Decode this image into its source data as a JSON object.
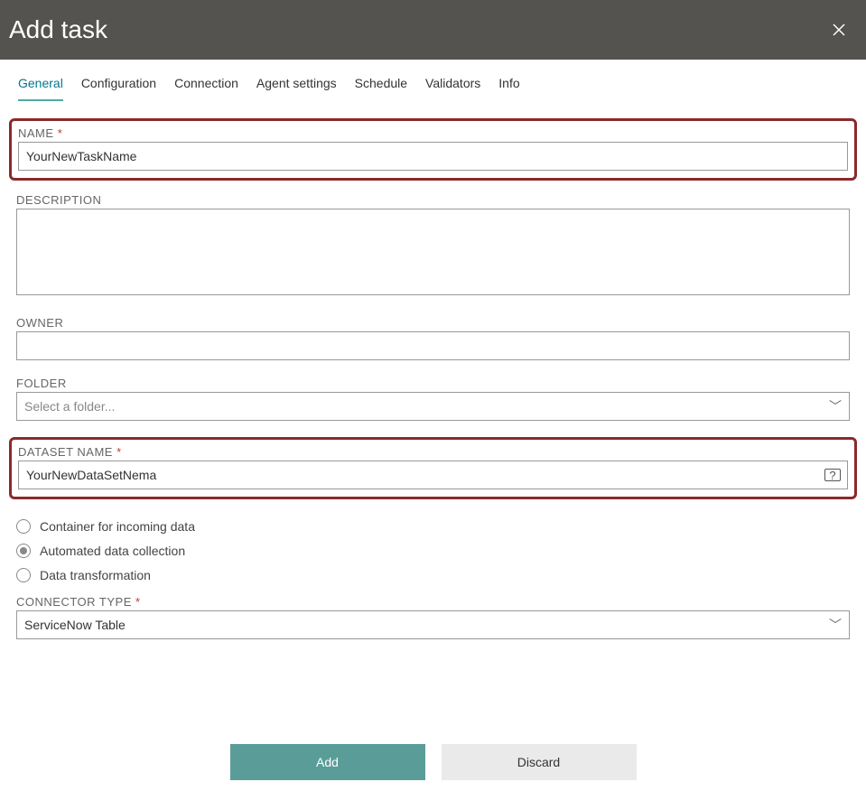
{
  "header": {
    "title": "Add task"
  },
  "tabs": [
    {
      "label": "General",
      "active": true
    },
    {
      "label": "Configuration",
      "active": false
    },
    {
      "label": "Connection",
      "active": false
    },
    {
      "label": "Agent settings",
      "active": false
    },
    {
      "label": "Schedule",
      "active": false
    },
    {
      "label": "Validators",
      "active": false
    },
    {
      "label": "Info",
      "active": false
    }
  ],
  "fields": {
    "name": {
      "label": "NAME",
      "required": true,
      "value": "YourNewTaskName"
    },
    "description": {
      "label": "DESCRIPTION",
      "value": ""
    },
    "owner": {
      "label": "OWNER",
      "value": ""
    },
    "folder": {
      "label": "FOLDER",
      "placeholder": "Select a folder..."
    },
    "datasetName": {
      "label": "DATASET NAME",
      "required": true,
      "value": "YourNewDataSetNema"
    },
    "connectorType": {
      "label": "CONNECTOR TYPE",
      "required": true,
      "value": "ServiceNow Table"
    }
  },
  "radios": [
    {
      "label": "Container for incoming data",
      "selected": false
    },
    {
      "label": "Automated data collection",
      "selected": true
    },
    {
      "label": "Data transformation",
      "selected": false
    }
  ],
  "buttons": {
    "add": "Add",
    "discard": "Discard"
  },
  "required_marker": "*"
}
